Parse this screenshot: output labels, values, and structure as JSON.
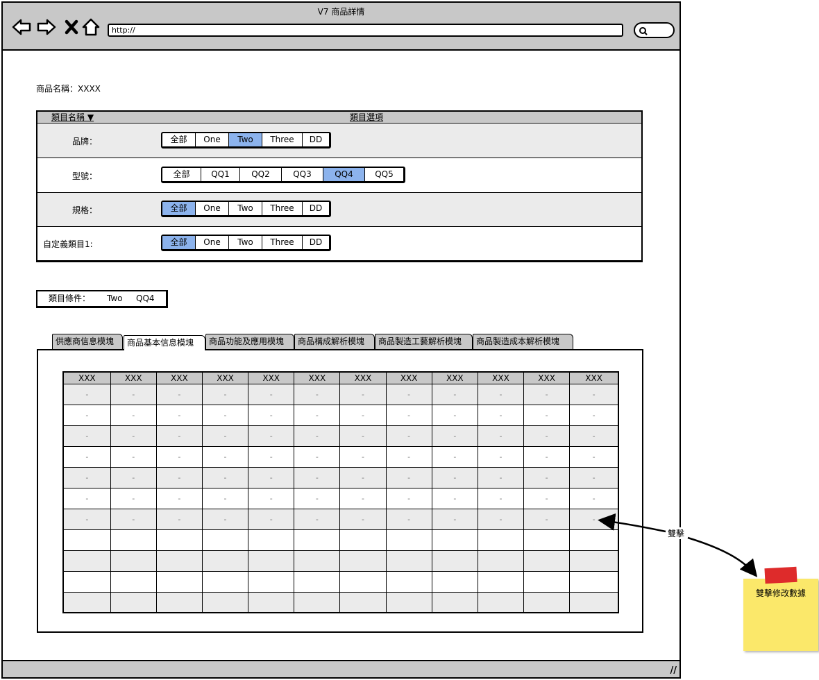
{
  "window": {
    "title": "V7 商品詳情",
    "address": "http://",
    "icons": [
      "back-arrow-icon",
      "forward-arrow-icon",
      "close-x-icon",
      "home-icon",
      "search-icon",
      "resize-grip-icon"
    ]
  },
  "product": {
    "name_label": "商品名稱：XXXX"
  },
  "category_panel": {
    "header_name": "類目名稱 ▼",
    "header_options": "類目選項",
    "rows": [
      {
        "label": "品牌：",
        "options": [
          "全部",
          "One",
          "Two",
          "Three",
          "DD"
        ],
        "selected": "Two"
      },
      {
        "label": "型號：",
        "options": [
          "全部",
          "QQ1",
          "QQ2",
          "QQ3",
          "QQ4",
          "QQ5"
        ],
        "selected": "QQ4"
      },
      {
        "label": "規格：",
        "options": [
          "全部",
          "One",
          "Two",
          "Three",
          "DD"
        ],
        "selected": "全部"
      },
      {
        "label": "自定義類目1:",
        "options": [
          "全部",
          "One",
          "Two",
          "Three",
          "DD"
        ],
        "selected": "全部"
      }
    ]
  },
  "conditions": {
    "label": "類目條件：",
    "values": [
      "Two",
      "QQ4"
    ]
  },
  "tabs": {
    "items": [
      "供應商信息模塊",
      "商品基本信息模塊",
      "商品功能及應用模塊",
      "商品構成解析模塊",
      "商品製造工藝解析模塊",
      "商品製造成本解析模塊"
    ],
    "active": "商品基本信息模塊"
  },
  "grid": {
    "headers": [
      "XXX",
      "XXX",
      "XXX",
      "XXX",
      "XXX",
      "XXX",
      "XXX",
      "XXX",
      "XXX",
      "XXX",
      "XXX",
      "XXX"
    ],
    "rows": [
      [
        "-",
        "-",
        "-",
        "-",
        "-",
        "-",
        "-",
        "-",
        "-",
        "-",
        "-",
        "-"
      ],
      [
        "-",
        "-",
        "-",
        "-",
        "-",
        "-",
        "-",
        "-",
        "-",
        "-",
        "-",
        "-"
      ],
      [
        "-",
        "-",
        "-",
        "-",
        "-",
        "-",
        "-",
        "-",
        "-",
        "-",
        "-",
        "-"
      ],
      [
        "-",
        "-",
        "-",
        "-",
        "-",
        "-",
        "-",
        "-",
        "-",
        "-",
        "-",
        "-"
      ],
      [
        "-",
        "-",
        "-",
        "-",
        "-",
        "-",
        "-",
        "-",
        "-",
        "-",
        "-",
        "-"
      ],
      [
        "-",
        "-",
        "-",
        "-",
        "-",
        "-",
        "-",
        "-",
        "-",
        "-",
        "-",
        "-"
      ],
      [
        "-",
        "-",
        "-",
        "-",
        "-",
        "-",
        "-",
        "-",
        "-",
        "-",
        "-",
        "-"
      ],
      [
        "",
        "",
        "",
        "",
        "",
        "",
        "",
        "",
        "",
        "",
        "",
        ""
      ],
      [
        "",
        "",
        "",
        "",
        "",
        "",
        "",
        "",
        "",
        "",
        "",
        ""
      ],
      [
        "",
        "",
        "",
        "",
        "",
        "",
        "",
        "",
        "",
        "",
        "",
        ""
      ],
      [
        "",
        "",
        "",
        "",
        "",
        "",
        "",
        "",
        "",
        "",
        "",
        ""
      ]
    ]
  },
  "annotation": {
    "arrow_label": "雙擊",
    "sticky_note": "雙擊修改數據",
    "colors": {
      "sticky": "#fbe86a",
      "tape": "#de2b2b"
    }
  },
  "colors": {
    "chrome": "#c8c8c8",
    "selected_option": "#8cb3ed",
    "row_shade": "#ebebeb"
  }
}
